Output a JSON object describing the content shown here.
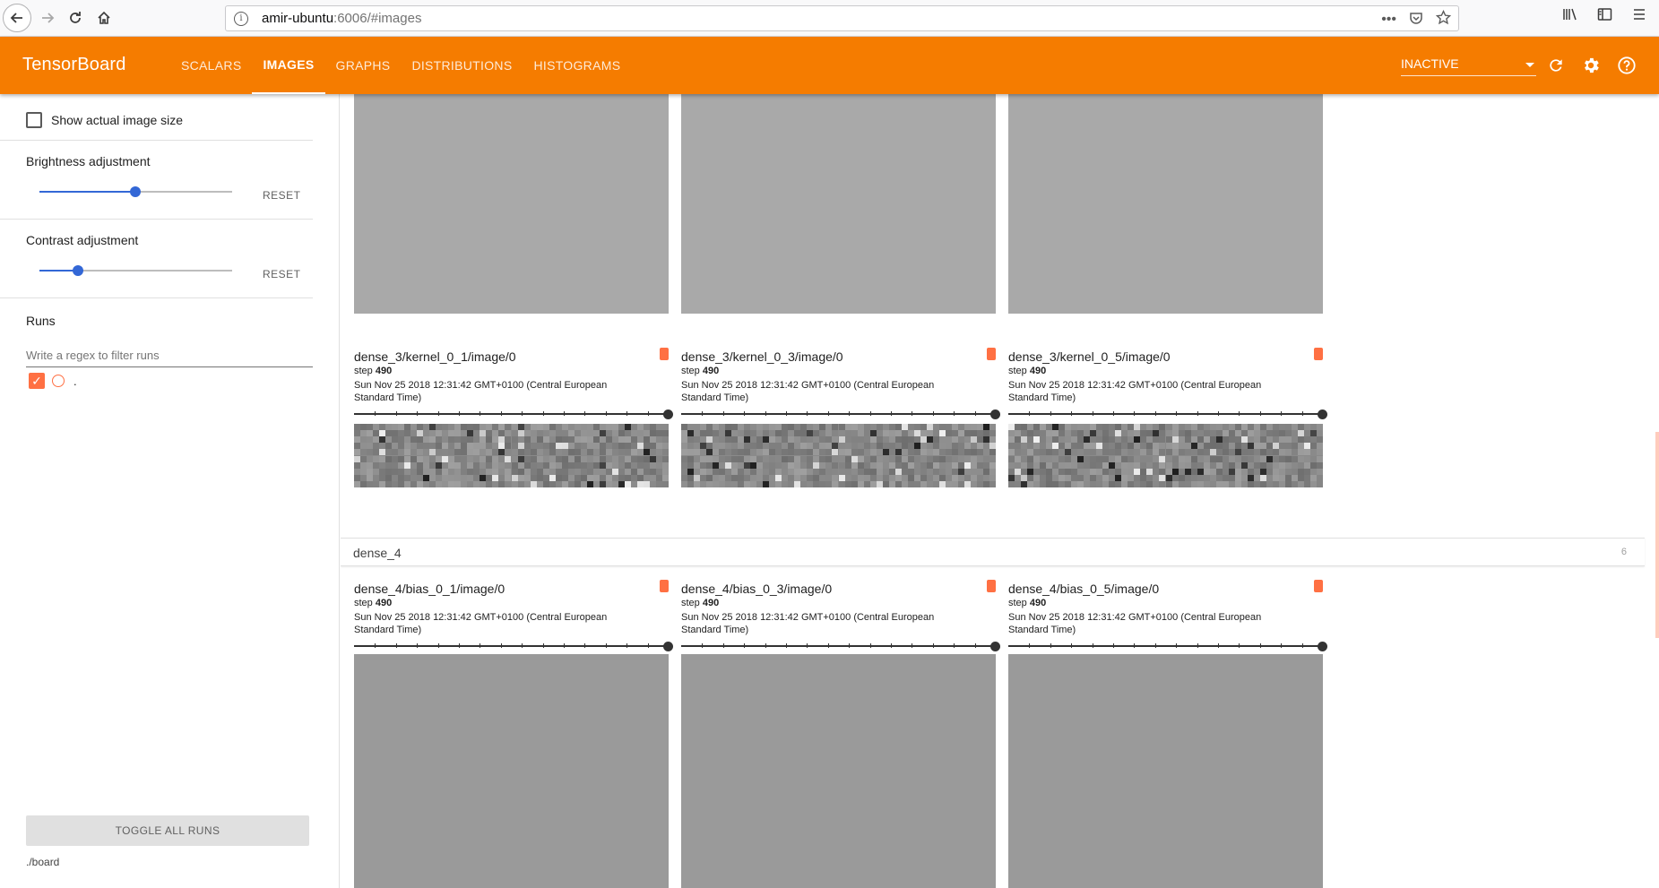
{
  "browser": {
    "url_host": "amir-ubuntu",
    "url_rest": ":6006/#images",
    "icons": [
      "back-arrow-icon",
      "forward-arrow-icon",
      "reload-icon",
      "home-icon",
      "info-icon",
      "more-icon",
      "pocket-icon",
      "bookmark-star-icon",
      "library-icon",
      "sidebar-icon",
      "menu-icon"
    ]
  },
  "header": {
    "title": "TensorBoard",
    "tabs": [
      {
        "label": "SCALARS",
        "active": false
      },
      {
        "label": "IMAGES",
        "active": true
      },
      {
        "label": "GRAPHS",
        "active": false
      },
      {
        "label": "DISTRIBUTIONS",
        "active": false
      },
      {
        "label": "HISTOGRAMS",
        "active": false
      }
    ],
    "select_value": "INACTIVE",
    "accent_color": "#f57c00"
  },
  "sidebar": {
    "show_actual_size_label": "Show actual image size",
    "brightness": {
      "label": "Brightness adjustment",
      "reset": "RESET",
      "value": 0.5
    },
    "contrast": {
      "label": "Contrast adjustment",
      "reset": "RESET",
      "value": 0.2
    },
    "runs_heading": "Runs",
    "filter_placeholder": "Write a regex to filter runs",
    "run_name": ".",
    "toggle_all": "TOGGLE ALL RUNS",
    "logdir": "./board"
  },
  "main": {
    "dense3_cards": [
      {
        "title": "dense_3/kernel_0_1/image/0",
        "step_label": "step",
        "step": "490",
        "time": "Sun Nov 25 2018 12:31:42 GMT+0100 (Central European Standard Time)"
      },
      {
        "title": "dense_3/kernel_0_3/image/0",
        "step_label": "step",
        "step": "490",
        "time": "Sun Nov 25 2018 12:31:42 GMT+0100 (Central European Standard Time)"
      },
      {
        "title": "dense_3/kernel_0_5/image/0",
        "step_label": "step",
        "step": "490",
        "time": "Sun Nov 25 2018 12:31:42 GMT+0100 (Central European Standard Time)"
      }
    ],
    "dense4_group": {
      "name": "dense_4",
      "count": "6"
    },
    "dense4_cards": [
      {
        "title": "dense_4/bias_0_1/image/0",
        "step_label": "step",
        "step": "490",
        "time": "Sun Nov 25 2018 12:31:42 GMT+0100 (Central European Standard Time)"
      },
      {
        "title": "dense_4/bias_0_3/image/0",
        "step_label": "step",
        "step": "490",
        "time": "Sun Nov 25 2018 12:31:42 GMT+0100 (Central European Standard Time)"
      },
      {
        "title": "dense_4/bias_0_5/image/0",
        "step_label": "step",
        "step": "490",
        "time": "Sun Nov 25 2018 12:31:42 GMT+0100 (Central European Standard Time)"
      }
    ]
  }
}
